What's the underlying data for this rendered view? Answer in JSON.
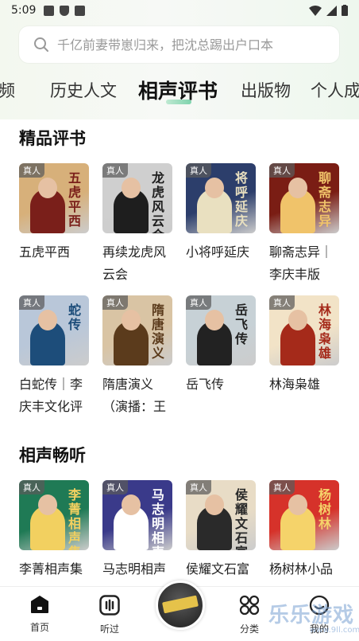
{
  "status_bar": {
    "time": "5:09"
  },
  "search": {
    "placeholder": "千亿前妻带崽归来，把沈总踢出户口本"
  },
  "tabs": [
    {
      "label": "频"
    },
    {
      "label": "历史人文"
    },
    {
      "label": "相声评书"
    },
    {
      "label": "出版物"
    },
    {
      "label": "个人成"
    }
  ],
  "sections": [
    {
      "title": "精品评书",
      "items": [
        {
          "badge": "真人",
          "cover_text": "五虎平西",
          "title": "五虎平西",
          "color": "#d7b07a",
          "accent": "#7a1f1a"
        },
        {
          "badge": "真人",
          "cover_text": "龙虎风云会",
          "title": "再续龙虎风云会",
          "color": "#cfcfcf",
          "accent": "#1e1e1e"
        },
        {
          "badge": "真人",
          "cover_text": "将呼延庆",
          "title": "小将呼延庆",
          "color": "#2c3e6b",
          "accent": "#e9e0c0"
        },
        {
          "badge": "真人",
          "cover_text": "聊斋志异",
          "title": "聊斋志异｜李庆丰版",
          "color": "#7a1d14",
          "accent": "#f0c36a"
        },
        {
          "badge": "真人",
          "cover_text": "蛇传",
          "title": "白蛇传｜李庆丰文化评",
          "color": "#b9c7d9",
          "accent": "#1d4d7a"
        },
        {
          "badge": "真人",
          "cover_text": "隋唐演义",
          "title": "隋唐演义（演播：王",
          "color": "#d9c4a4",
          "accent": "#5b3b1c"
        },
        {
          "badge": "真人",
          "cover_text": "岳飞传",
          "title": "岳飞传",
          "color": "#c7d1d6",
          "accent": "#222222"
        },
        {
          "badge": "真人",
          "cover_text": "林海枭雄",
          "title": "林海枭雄",
          "color": "#f2e3c7",
          "accent": "#a52a1a"
        }
      ]
    },
    {
      "title": "相声畅听",
      "items": [
        {
          "badge": "真人",
          "cover_text": "李菁相声集",
          "title": "李菁相声集",
          "color": "#1f7a55",
          "accent": "#f2d060"
        },
        {
          "badge": "真人",
          "cover_text": "马志明相声",
          "title": "马志明相声集",
          "color": "#3a3a8a",
          "accent": "#ffffff"
        },
        {
          "badge": "真人",
          "cover_text": "侯耀文石富宽",
          "title": "侯耀文石富宽相声精选",
          "color": "#e8dcc6",
          "accent": "#2a2a2a"
        },
        {
          "badge": "真人",
          "cover_text": "杨树林",
          "title": "杨树林小品集",
          "color": "#d6322a",
          "accent": "#f5d36a"
        }
      ]
    }
  ],
  "bottom_nav": {
    "home": "首页",
    "listened": "听过",
    "category": "分类",
    "mine": "我的"
  },
  "watermark": {
    "text": "乐乐游戏",
    "sub": "www.9ll.com"
  }
}
